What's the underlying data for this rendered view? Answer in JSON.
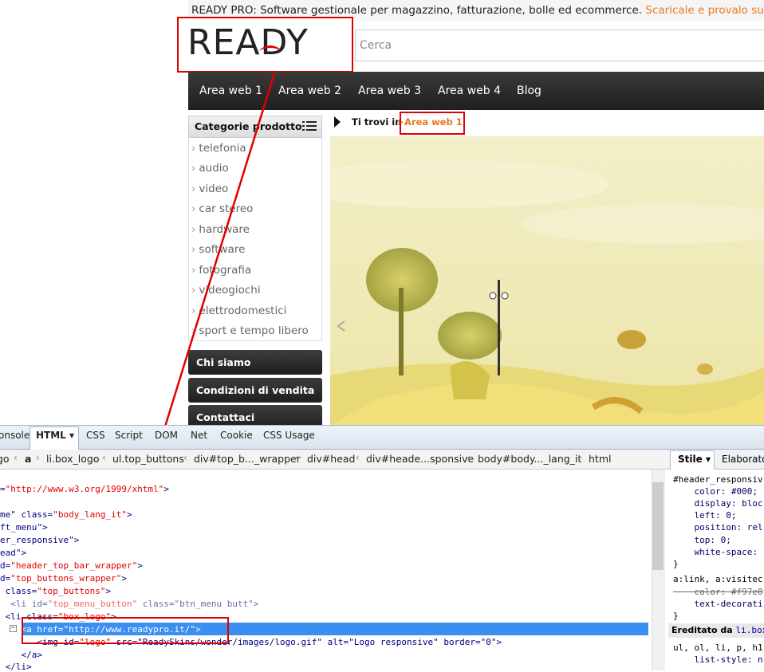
{
  "website": {
    "topbar": {
      "text": "READY PRO: Software gestionale per magazzino, fatturazione, bolle ed ecommerce.",
      "link": "Scaricale e provalo subito."
    },
    "logo": "READY",
    "search_placeholder": "Cerca",
    "nav": [
      "Area web 1",
      "Area web 2",
      "Area web 3",
      "Area web 4",
      "Blog"
    ],
    "categories": {
      "title": "Categorie prodotto",
      "items": [
        "telefonia",
        "audio",
        "video",
        "car stereo",
        "hardware",
        "software",
        "fotografia",
        "videogiochi",
        "elettrodomestici",
        "sport e tempo libero"
      ]
    },
    "side_buttons": [
      "Chi siamo",
      "Condizioni di vendita",
      "Contattaci"
    ],
    "breadcrumb": {
      "label": "Ti trovi in",
      "sep": ">",
      "current": "Area web 1"
    }
  },
  "devtools": {
    "tabs": [
      "onsole",
      "HTML",
      "CSS",
      "Script",
      "DOM",
      "Net",
      "Cookie",
      "CSS Usage"
    ],
    "active_tab_arrow": "▾",
    "breadcrumb": [
      "go",
      "a",
      "li.box_logo",
      "ul.top_buttons",
      "div#top_b..._wrapper",
      "div#head",
      "div#heade...sponsive",
      "body#body..._lang_it",
      "html"
    ],
    "code_lines": [
      {
        "pre": "=",
        "str": "\"http://www.w3.org/1999/xhtml\"",
        "post": ">"
      },
      {
        "pre": "",
        "str": "",
        "post": ""
      },
      {
        "pre": "me\" class=",
        "str": "\"body_lang_it\"",
        "post": ">"
      },
      {
        "pre": "ft_menu\"",
        "str": "",
        "post": ">"
      },
      {
        "pre": "er_responsive\"",
        "str": "",
        "post": ">"
      },
      {
        "pre": "ead\"",
        "str": "",
        "post": ">"
      },
      {
        "pre": "d=",
        "str": "\"header_top_bar_wrapper\"",
        "post": ">"
      },
      {
        "pre": "d=",
        "str": "\"top_buttons_wrapper\"",
        "post": ">"
      },
      {
        "pre": " class=",
        "str": "\"top_buttons\"",
        "post": ">"
      },
      {
        "pre": "  <li id=",
        "str": "\"top_menu_button\"",
        "post": " class=\"btn_menu butt\">"
      },
      {
        "pre": " <li class=",
        "str": "\"box_logo\"",
        "post": ">"
      },
      {
        "pre": "    <a href=",
        "str": "\"http://www.readypro.it/\"",
        "post": ">"
      },
      {
        "pre": "       <img id=",
        "str": "\"logo\"",
        "post": " src=\"ReadySkins/wonder/images/logo.gif\" alt=\"Logo responsive\" border=\"0\">"
      },
      {
        "pre": "    </a>",
        "str": "",
        "post": ""
      },
      {
        "pre": " </li>",
        "str": "",
        "post": ""
      }
    ],
    "side_tabs": [
      "Stile",
      "Elaborato"
    ],
    "side_tab_arrow": "▾",
    "styles": [
      "#header_responsiv",
      "    color: #000;",
      "    display: bloc",
      "    left: 0;",
      "    position: rel",
      "    top: 0;",
      "    white-space:",
      "}",
      "a:link, a:visitec",
      "    color: #f97e0",
      "    text-decorati",
      "}"
    ],
    "inherited_label": "Ereditato da",
    "inherited_from": "li.box_",
    "more_styles": [
      "ul, ol, li, p, h1",
      "    list-style: n"
    ]
  },
  "colors": {
    "accent": "#e8791e",
    "annotation": "#e00000",
    "selection": "#3b8ff0"
  }
}
